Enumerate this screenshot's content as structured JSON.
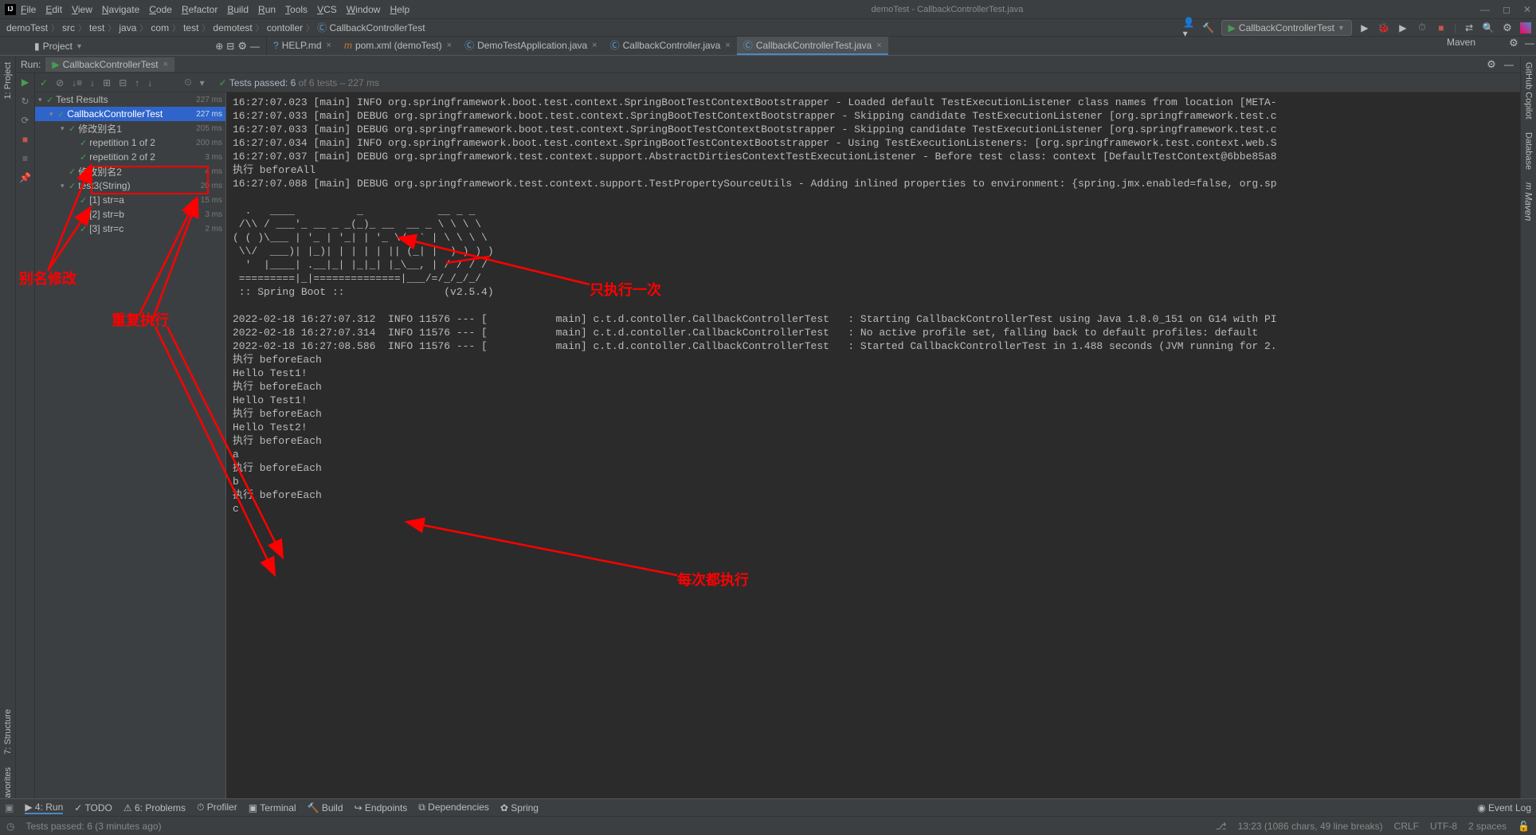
{
  "window": {
    "title": "demoTest - CallbackControllerTest.java"
  },
  "menu": [
    "File",
    "Edit",
    "View",
    "Navigate",
    "Code",
    "Refactor",
    "Build",
    "Run",
    "Tools",
    "VCS",
    "Window",
    "Help"
  ],
  "breadcrumbs": [
    "demoTest",
    "src",
    "test",
    "java",
    "com",
    "test",
    "demotest",
    "contoller",
    "CallbackControllerTest"
  ],
  "run_config": {
    "label": "CallbackControllerTest"
  },
  "project_tool": {
    "label": "Project"
  },
  "editor_tabs": [
    {
      "label": "HELP.md",
      "icon": "md",
      "active": false
    },
    {
      "label": "pom.xml (demoTest)",
      "icon": "maven",
      "active": false
    },
    {
      "label": "DemoTestApplication.java",
      "icon": "class",
      "active": false
    },
    {
      "label": "CallbackController.java",
      "icon": "class",
      "active": false
    },
    {
      "label": "CallbackControllerTest.java",
      "icon": "class",
      "active": true
    }
  ],
  "maven_tool": "Maven",
  "left_sidebar": [
    "1: Project"
  ],
  "right_sidebar": [
    "GitHub Copilot",
    "Database",
    "Maven"
  ],
  "run_panel": {
    "title": "Run:",
    "tab_label": "CallbackControllerTest",
    "tests_status": {
      "passed_label": "Tests passed:",
      "count": "6",
      "of": " of 6 tests",
      "time": " – 227 ms"
    }
  },
  "test_tree": [
    {
      "level": 0,
      "name": "Test Results",
      "time": "227 ms",
      "expanded": true
    },
    {
      "level": 1,
      "name": "CallbackControllerTest",
      "time": "227 ms",
      "expanded": true,
      "selected": true
    },
    {
      "level": 2,
      "name": "修改别名1",
      "time": "205 ms",
      "expanded": true
    },
    {
      "level": 3,
      "name": "repetition 1 of 2",
      "time": "200 ms"
    },
    {
      "level": 3,
      "name": "repetition 2 of 2",
      "time": "3 ms"
    },
    {
      "level": 2,
      "name": "修改别名2",
      "time": "4 ms"
    },
    {
      "level": 2,
      "name": "test3(String)",
      "time": "20 ms",
      "expanded": true
    },
    {
      "level": 3,
      "name": "[1] str=a",
      "time": "15 ms"
    },
    {
      "level": 3,
      "name": "[2] str=b",
      "time": "3 ms"
    },
    {
      "level": 3,
      "name": "[3] str=c",
      "time": "2 ms"
    }
  ],
  "console_lines": [
    "16:27:07.023 [main] INFO org.springframework.boot.test.context.SpringBootTestContextBootstrapper - Loaded default TestExecutionListener class names from location [META-",
    "16:27:07.033 [main] DEBUG org.springframework.boot.test.context.SpringBootTestContextBootstrapper - Skipping candidate TestExecutionListener [org.springframework.test.c",
    "16:27:07.033 [main] DEBUG org.springframework.boot.test.context.SpringBootTestContextBootstrapper - Skipping candidate TestExecutionListener [org.springframework.test.c",
    "16:27:07.034 [main] INFO org.springframework.boot.test.context.SpringBootTestContextBootstrapper - Using TestExecutionListeners: [org.springframework.test.context.web.S",
    "16:27:07.037 [main] DEBUG org.springframework.test.context.support.AbstractDirtiesContextTestExecutionListener - Before test class: context [DefaultTestContext@6bbe85a8",
    "执行 beforeAll",
    "16:27:07.088 [main] DEBUG org.springframework.test.context.support.TestPropertySourceUtils - Adding inlined properties to environment: {spring.jmx.enabled=false, org.sp",
    "",
    "  .   ____          _            __ _ _",
    " /\\\\ / ___'_ __ _ _(_)_ __  __ _ \\ \\ \\ \\",
    "( ( )\\___ | '_ | '_| | '_ \\/ _` | \\ \\ \\ \\",
    " \\\\/  ___)| |_)| | | | | || (_| |  ) ) ) )",
    "  '  |____| .__|_| |_|_| |_\\__, | / / / /",
    " =========|_|==============|___/=/_/_/_/",
    " :: Spring Boot ::                (v2.5.4)",
    "",
    "2022-02-18 16:27:07.312  INFO 11576 --- [           main] c.t.d.contoller.CallbackControllerTest   : Starting CallbackControllerTest using Java 1.8.0_151 on G14 with PI",
    "2022-02-18 16:27:07.314  INFO 11576 --- [           main] c.t.d.contoller.CallbackControllerTest   : No active profile set, falling back to default profiles: default",
    "2022-02-18 16:27:08.586  INFO 11576 --- [           main] c.t.d.contoller.CallbackControllerTest   : Started CallbackControllerTest in 1.488 seconds (JVM running for 2.",
    "执行 beforeEach",
    "Hello Test1!",
    "执行 beforeEach",
    "Hello Test1!",
    "执行 beforeEach",
    "Hello Test2!",
    "执行 beforeEach",
    "a",
    "执行 beforeEach",
    "b",
    "执行 beforeEach",
    "c"
  ],
  "annotations": {
    "rename": "别名修改",
    "repeat": "重复执行",
    "once": "只执行一次",
    "each": "每次都执行"
  },
  "bottom_tools": [
    "4: Run",
    "TODO",
    "6: Problems",
    "Profiler",
    "Terminal",
    "Build",
    "Endpoints",
    "Dependencies",
    "Spring"
  ],
  "bottom_right": "Event Log",
  "status": {
    "msg": "Tests passed: 6 (3 minutes ago)",
    "caret": "13:23 (1086 chars, 49 line breaks)",
    "sep": "CRLF",
    "enc": "UTF-8",
    "indent": "2 spaces"
  }
}
